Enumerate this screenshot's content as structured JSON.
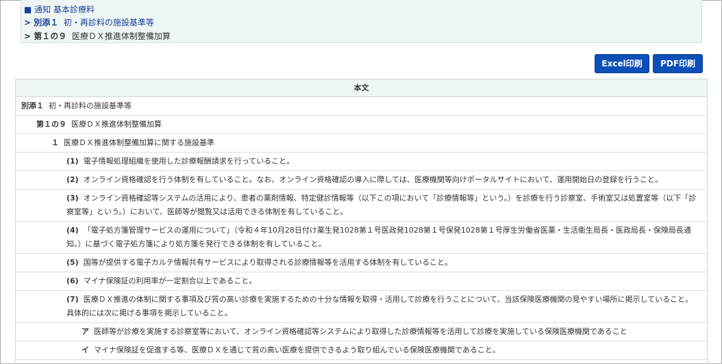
{
  "breadcrumb": {
    "item1_marker": "■",
    "item1": "通知 基本診療料",
    "item2_prefix": "> 別添１",
    "item2": "初・再診料の施設基準等",
    "item3_prefix": "> 第１の９",
    "item3": "医療ＤＸ推進体制整備加算"
  },
  "toolbar": {
    "excel_label": "Excel印刷",
    "pdf_label": "PDF印刷"
  },
  "table": {
    "header": "本文",
    "rows": [
      {
        "num": "別添１",
        "text": "初・再診料の施設基準等"
      },
      {
        "num": "第１の９",
        "text": "医療ＤＸ推進体制整備加算"
      },
      {
        "num": "１",
        "text": "医療ＤＸ推進体制整備加算に関する施設基準"
      },
      {
        "num": "(1)",
        "text": "電子情報処理組織を使用した診療報酬請求を行っていること。"
      },
      {
        "num": "(2)",
        "text": "オンライン資格確認を行う体制を有していること。なお、オンライン資格確認の導入に際しては、医療機関等向けポータルサイトにおいて、運用開始日の登録を行うこと。"
      },
      {
        "num": "(3)",
        "text": "オンライン資格確認等システムの活用により、患者の薬剤情報、特定健診情報等（以下この項において「診療情報等」という。）を診療を行う診察室、手術室又は処置室等（以下「診察室等」という。）において、医師等が閲覧又は活用できる体制を有していること。"
      },
      {
        "num": "(4)",
        "text": "「電子処方箋管理サービスの運用について」（令和４年10月28日付け薬生発1028第１号医政発1028第１号保発1028第１号厚生労働省医薬・生活衛生局長・医政局長・保険局長通知。）に基づく電子処方箋により処方箋を発行できる体制を有していること。"
      },
      {
        "num": "(5)",
        "text": "国等が提供する電子カルテ情報共有サービスにより取得される診療情報等を活用する体制を有していること。"
      },
      {
        "num": "(6)",
        "text": "マイナ保険証の利用率が一定割合以上であること。"
      },
      {
        "num": "(7)",
        "text": "医療ＤＸ推進の体制に関する事項及び質の高い診療を実施するための十分な情報を取得・活用して診療を行うことについて、当該保険医療機関の見やすい場所に掲示していること。具体的には次に掲げる事項を掲示していること。"
      },
      {
        "num": "ア",
        "text": "医師等が診療を実施する診察室等において、オンライン資格確認等システムにより取得した診療情報等を活用して診療を実施している保険医療機関であること"
      },
      {
        "num": "イ",
        "text": "マイナ保険証を促進する等、医療ＤＸを通じて質の高い医療を提供できるよう取り組んでいる保険医療機関であること。"
      }
    ]
  }
}
